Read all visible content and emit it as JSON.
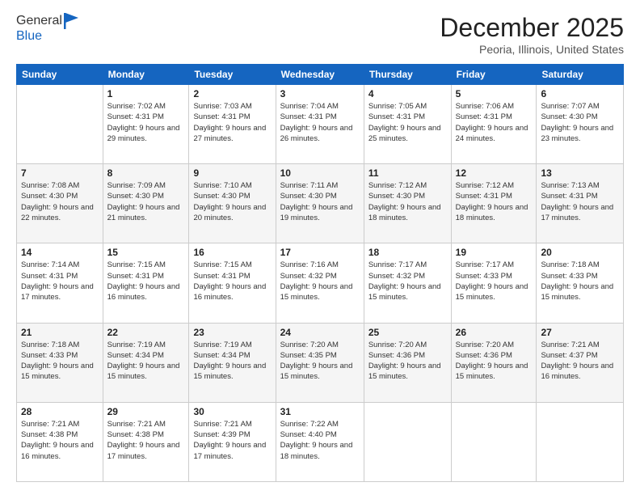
{
  "header": {
    "logo_line1": "General",
    "logo_line2": "Blue",
    "month_title": "December 2025",
    "location": "Peoria, Illinois, United States"
  },
  "days_of_week": [
    "Sunday",
    "Monday",
    "Tuesday",
    "Wednesday",
    "Thursday",
    "Friday",
    "Saturday"
  ],
  "weeks": [
    [
      {
        "day": "",
        "sunrise": "",
        "sunset": "",
        "daylight": ""
      },
      {
        "day": "1",
        "sunrise": "Sunrise: 7:02 AM",
        "sunset": "Sunset: 4:31 PM",
        "daylight": "Daylight: 9 hours and 29 minutes."
      },
      {
        "day": "2",
        "sunrise": "Sunrise: 7:03 AM",
        "sunset": "Sunset: 4:31 PM",
        "daylight": "Daylight: 9 hours and 27 minutes."
      },
      {
        "day": "3",
        "sunrise": "Sunrise: 7:04 AM",
        "sunset": "Sunset: 4:31 PM",
        "daylight": "Daylight: 9 hours and 26 minutes."
      },
      {
        "day": "4",
        "sunrise": "Sunrise: 7:05 AM",
        "sunset": "Sunset: 4:31 PM",
        "daylight": "Daylight: 9 hours and 25 minutes."
      },
      {
        "day": "5",
        "sunrise": "Sunrise: 7:06 AM",
        "sunset": "Sunset: 4:31 PM",
        "daylight": "Daylight: 9 hours and 24 minutes."
      },
      {
        "day": "6",
        "sunrise": "Sunrise: 7:07 AM",
        "sunset": "Sunset: 4:30 PM",
        "daylight": "Daylight: 9 hours and 23 minutes."
      }
    ],
    [
      {
        "day": "7",
        "sunrise": "Sunrise: 7:08 AM",
        "sunset": "Sunset: 4:30 PM",
        "daylight": "Daylight: 9 hours and 22 minutes."
      },
      {
        "day": "8",
        "sunrise": "Sunrise: 7:09 AM",
        "sunset": "Sunset: 4:30 PM",
        "daylight": "Daylight: 9 hours and 21 minutes."
      },
      {
        "day": "9",
        "sunrise": "Sunrise: 7:10 AM",
        "sunset": "Sunset: 4:30 PM",
        "daylight": "Daylight: 9 hours and 20 minutes."
      },
      {
        "day": "10",
        "sunrise": "Sunrise: 7:11 AM",
        "sunset": "Sunset: 4:30 PM",
        "daylight": "Daylight: 9 hours and 19 minutes."
      },
      {
        "day": "11",
        "sunrise": "Sunrise: 7:12 AM",
        "sunset": "Sunset: 4:30 PM",
        "daylight": "Daylight: 9 hours and 18 minutes."
      },
      {
        "day": "12",
        "sunrise": "Sunrise: 7:12 AM",
        "sunset": "Sunset: 4:31 PM",
        "daylight": "Daylight: 9 hours and 18 minutes."
      },
      {
        "day": "13",
        "sunrise": "Sunrise: 7:13 AM",
        "sunset": "Sunset: 4:31 PM",
        "daylight": "Daylight: 9 hours and 17 minutes."
      }
    ],
    [
      {
        "day": "14",
        "sunrise": "Sunrise: 7:14 AM",
        "sunset": "Sunset: 4:31 PM",
        "daylight": "Daylight: 9 hours and 17 minutes."
      },
      {
        "day": "15",
        "sunrise": "Sunrise: 7:15 AM",
        "sunset": "Sunset: 4:31 PM",
        "daylight": "Daylight: 9 hours and 16 minutes."
      },
      {
        "day": "16",
        "sunrise": "Sunrise: 7:15 AM",
        "sunset": "Sunset: 4:31 PM",
        "daylight": "Daylight: 9 hours and 16 minutes."
      },
      {
        "day": "17",
        "sunrise": "Sunrise: 7:16 AM",
        "sunset": "Sunset: 4:32 PM",
        "daylight": "Daylight: 9 hours and 15 minutes."
      },
      {
        "day": "18",
        "sunrise": "Sunrise: 7:17 AM",
        "sunset": "Sunset: 4:32 PM",
        "daylight": "Daylight: 9 hours and 15 minutes."
      },
      {
        "day": "19",
        "sunrise": "Sunrise: 7:17 AM",
        "sunset": "Sunset: 4:33 PM",
        "daylight": "Daylight: 9 hours and 15 minutes."
      },
      {
        "day": "20",
        "sunrise": "Sunrise: 7:18 AM",
        "sunset": "Sunset: 4:33 PM",
        "daylight": "Daylight: 9 hours and 15 minutes."
      }
    ],
    [
      {
        "day": "21",
        "sunrise": "Sunrise: 7:18 AM",
        "sunset": "Sunset: 4:33 PM",
        "daylight": "Daylight: 9 hours and 15 minutes."
      },
      {
        "day": "22",
        "sunrise": "Sunrise: 7:19 AM",
        "sunset": "Sunset: 4:34 PM",
        "daylight": "Daylight: 9 hours and 15 minutes."
      },
      {
        "day": "23",
        "sunrise": "Sunrise: 7:19 AM",
        "sunset": "Sunset: 4:34 PM",
        "daylight": "Daylight: 9 hours and 15 minutes."
      },
      {
        "day": "24",
        "sunrise": "Sunrise: 7:20 AM",
        "sunset": "Sunset: 4:35 PM",
        "daylight": "Daylight: 9 hours and 15 minutes."
      },
      {
        "day": "25",
        "sunrise": "Sunrise: 7:20 AM",
        "sunset": "Sunset: 4:36 PM",
        "daylight": "Daylight: 9 hours and 15 minutes."
      },
      {
        "day": "26",
        "sunrise": "Sunrise: 7:20 AM",
        "sunset": "Sunset: 4:36 PM",
        "daylight": "Daylight: 9 hours and 15 minutes."
      },
      {
        "day": "27",
        "sunrise": "Sunrise: 7:21 AM",
        "sunset": "Sunset: 4:37 PM",
        "daylight": "Daylight: 9 hours and 16 minutes."
      }
    ],
    [
      {
        "day": "28",
        "sunrise": "Sunrise: 7:21 AM",
        "sunset": "Sunset: 4:38 PM",
        "daylight": "Daylight: 9 hours and 16 minutes."
      },
      {
        "day": "29",
        "sunrise": "Sunrise: 7:21 AM",
        "sunset": "Sunset: 4:38 PM",
        "daylight": "Daylight: 9 hours and 17 minutes."
      },
      {
        "day": "30",
        "sunrise": "Sunrise: 7:21 AM",
        "sunset": "Sunset: 4:39 PM",
        "daylight": "Daylight: 9 hours and 17 minutes."
      },
      {
        "day": "31",
        "sunrise": "Sunrise: 7:22 AM",
        "sunset": "Sunset: 4:40 PM",
        "daylight": "Daylight: 9 hours and 18 minutes."
      },
      {
        "day": "",
        "sunrise": "",
        "sunset": "",
        "daylight": ""
      },
      {
        "day": "",
        "sunrise": "",
        "sunset": "",
        "daylight": ""
      },
      {
        "day": "",
        "sunrise": "",
        "sunset": "",
        "daylight": ""
      }
    ]
  ]
}
